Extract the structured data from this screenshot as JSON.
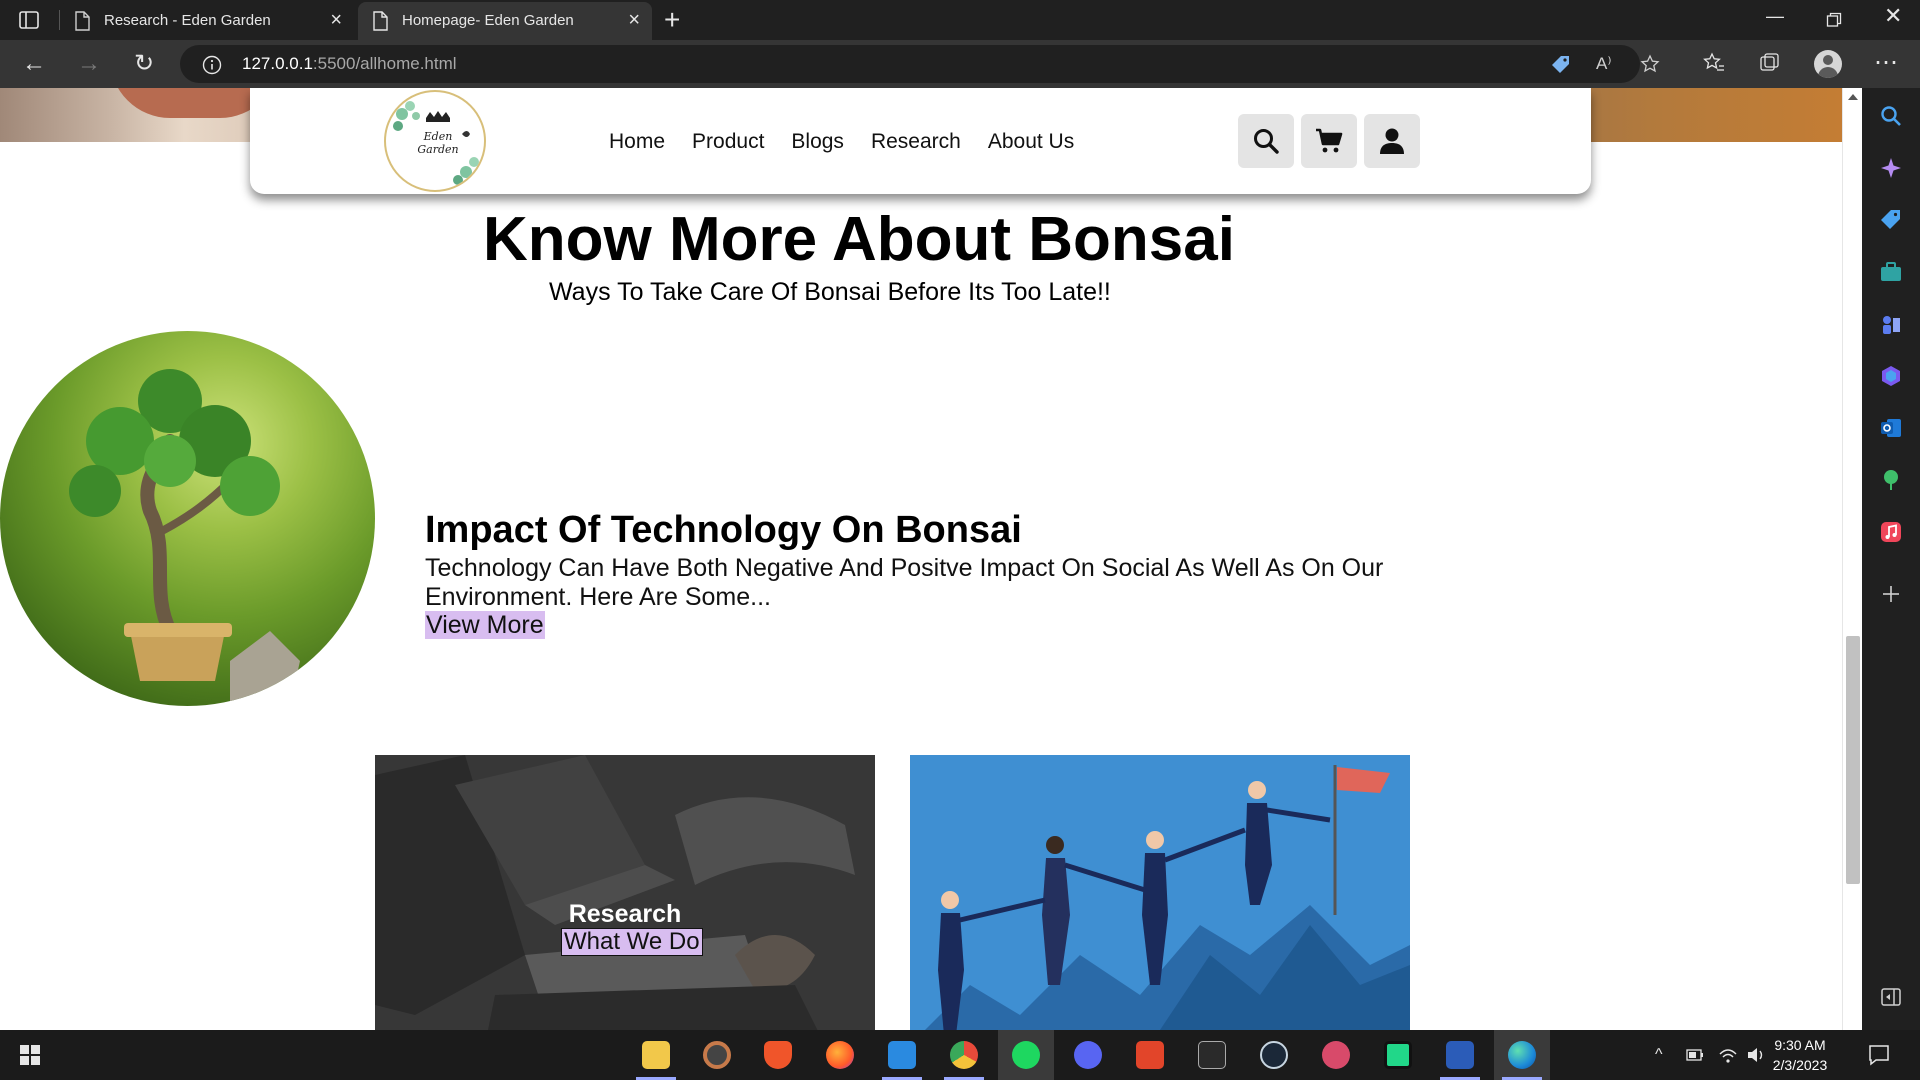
{
  "browser": {
    "tabs": [
      {
        "label": "Research - Eden Garden",
        "active": false
      },
      {
        "label": "Homepage- Eden Garden",
        "active": true
      }
    ],
    "address": {
      "host": "127.0.0.1",
      "rest": ":5500/allhome.html"
    }
  },
  "site": {
    "logo_text": "Eden Garden",
    "nav": [
      "Home",
      "Product",
      "Blogs",
      "Research",
      "About Us"
    ],
    "icons": [
      "search-icon",
      "cart-icon",
      "user-icon"
    ]
  },
  "page": {
    "heading": "Know More About Bonsai",
    "subheading": "Ways To Take Care Of Bonsai Before Its Too Late!!",
    "article": {
      "title": "Impact Of Technology On Bonsai",
      "body": "Technology Can Have Both Negative And Positve Impact On Social As Well As On Our Environment. Here Are Some...",
      "link": "View More"
    },
    "cards": [
      {
        "title": "Research",
        "link": "What We Do"
      }
    ]
  },
  "taskbar": {
    "clock": {
      "time": "9:30 AM",
      "date": "2/3/2023"
    }
  },
  "colors": {
    "link_highlight": "#d8bdf0",
    "browser_dark": "#202020",
    "toolbar": "#353535",
    "card_blue": "#3f8fd2"
  }
}
